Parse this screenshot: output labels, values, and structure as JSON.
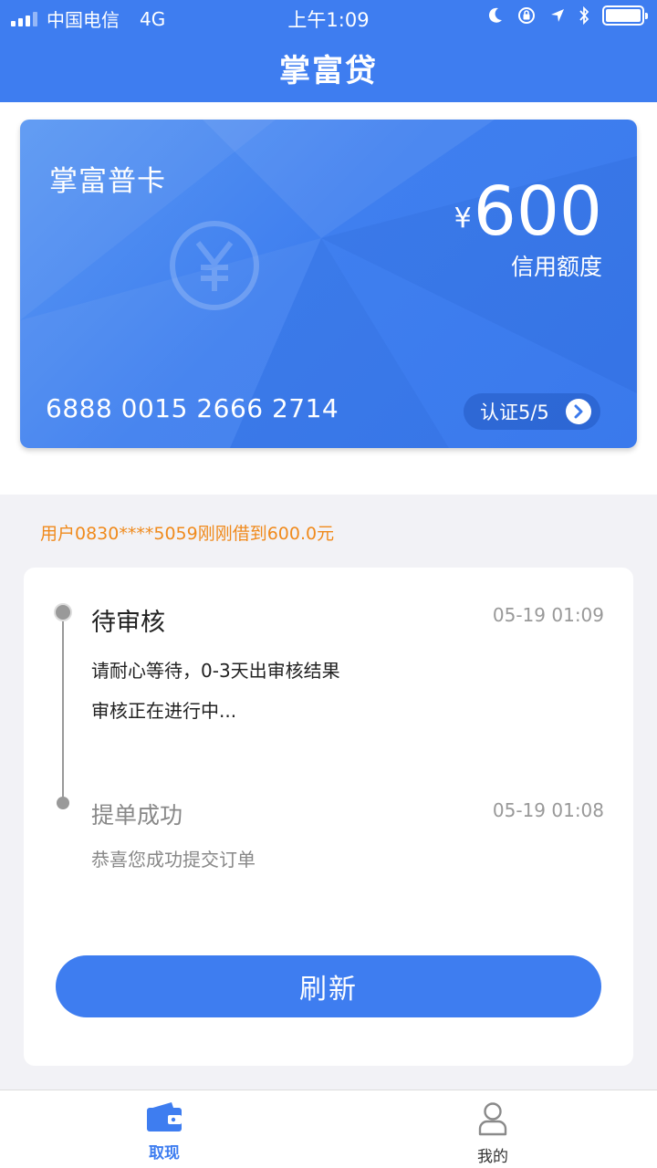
{
  "status_bar": {
    "carrier": "中国电信",
    "network": "4G",
    "time": "上午1:09"
  },
  "header": {
    "title": "掌富贷"
  },
  "card": {
    "name": "掌富普卡",
    "currency": "¥",
    "amount": "600",
    "amount_label": "信用额度",
    "number": "6888 0015 2666 2714",
    "verify_label": "认证5/5"
  },
  "notice": "用户0830****5059刚刚借到600.0元",
  "timeline": [
    {
      "title": "待审核",
      "time": "05-19 01:09",
      "lines": [
        "请耐心等待，0-3天出审核结果",
        "审核正在进行中..."
      ]
    },
    {
      "title": "提单成功",
      "time": "05-19 01:08",
      "lines": [
        "恭喜您成功提交订单"
      ]
    }
  ],
  "refresh_label": "刷新",
  "tabs": [
    {
      "label": "取现",
      "icon": "wallet-icon",
      "active": true
    },
    {
      "label": "我的",
      "icon": "person-icon",
      "active": false
    }
  ],
  "colors": {
    "brand": "#3e7df0",
    "notice": "#f08a1c"
  }
}
